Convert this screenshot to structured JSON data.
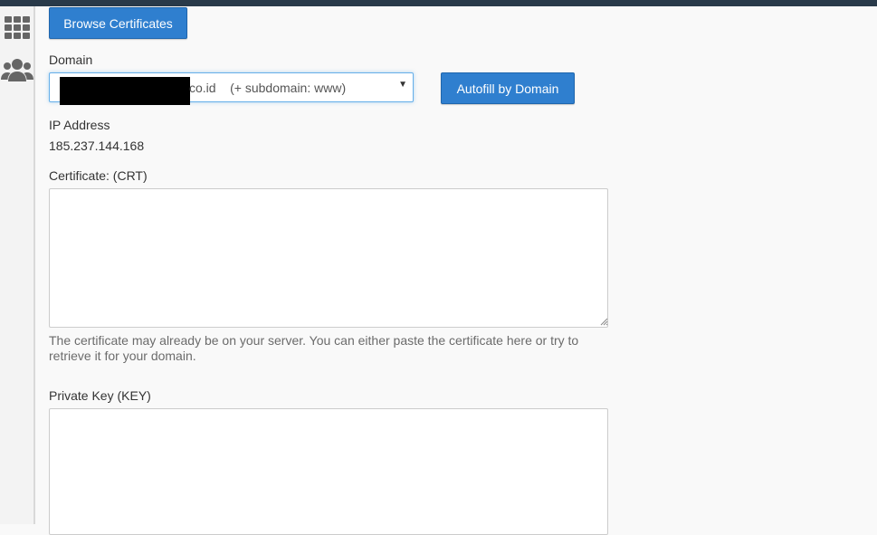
{
  "topbar": {
    "color": "#293a4a"
  },
  "sidebar": {
    "items": [
      {
        "icon": "grid-icon"
      },
      {
        "icon": "users-icon"
      }
    ]
  },
  "actions": {
    "browse_label": "Browse Certificates",
    "autofill_label": "Autofill by Domain"
  },
  "form": {
    "domain_label": "Domain",
    "domain_selected": "co.id    (+ subdomain: www)",
    "ip_label": "IP Address",
    "ip_value": "185.237.144.168",
    "crt_label": "Certificate: (CRT)",
    "crt_value": "",
    "crt_help": "The certificate may already be on your server. You can either paste the certificate here or try to retrieve it for your domain.",
    "key_label": "Private Key (KEY)",
    "key_value": ""
  },
  "colors": {
    "primary_button": "#2f7fcf",
    "focus_border": "#66afe9"
  }
}
